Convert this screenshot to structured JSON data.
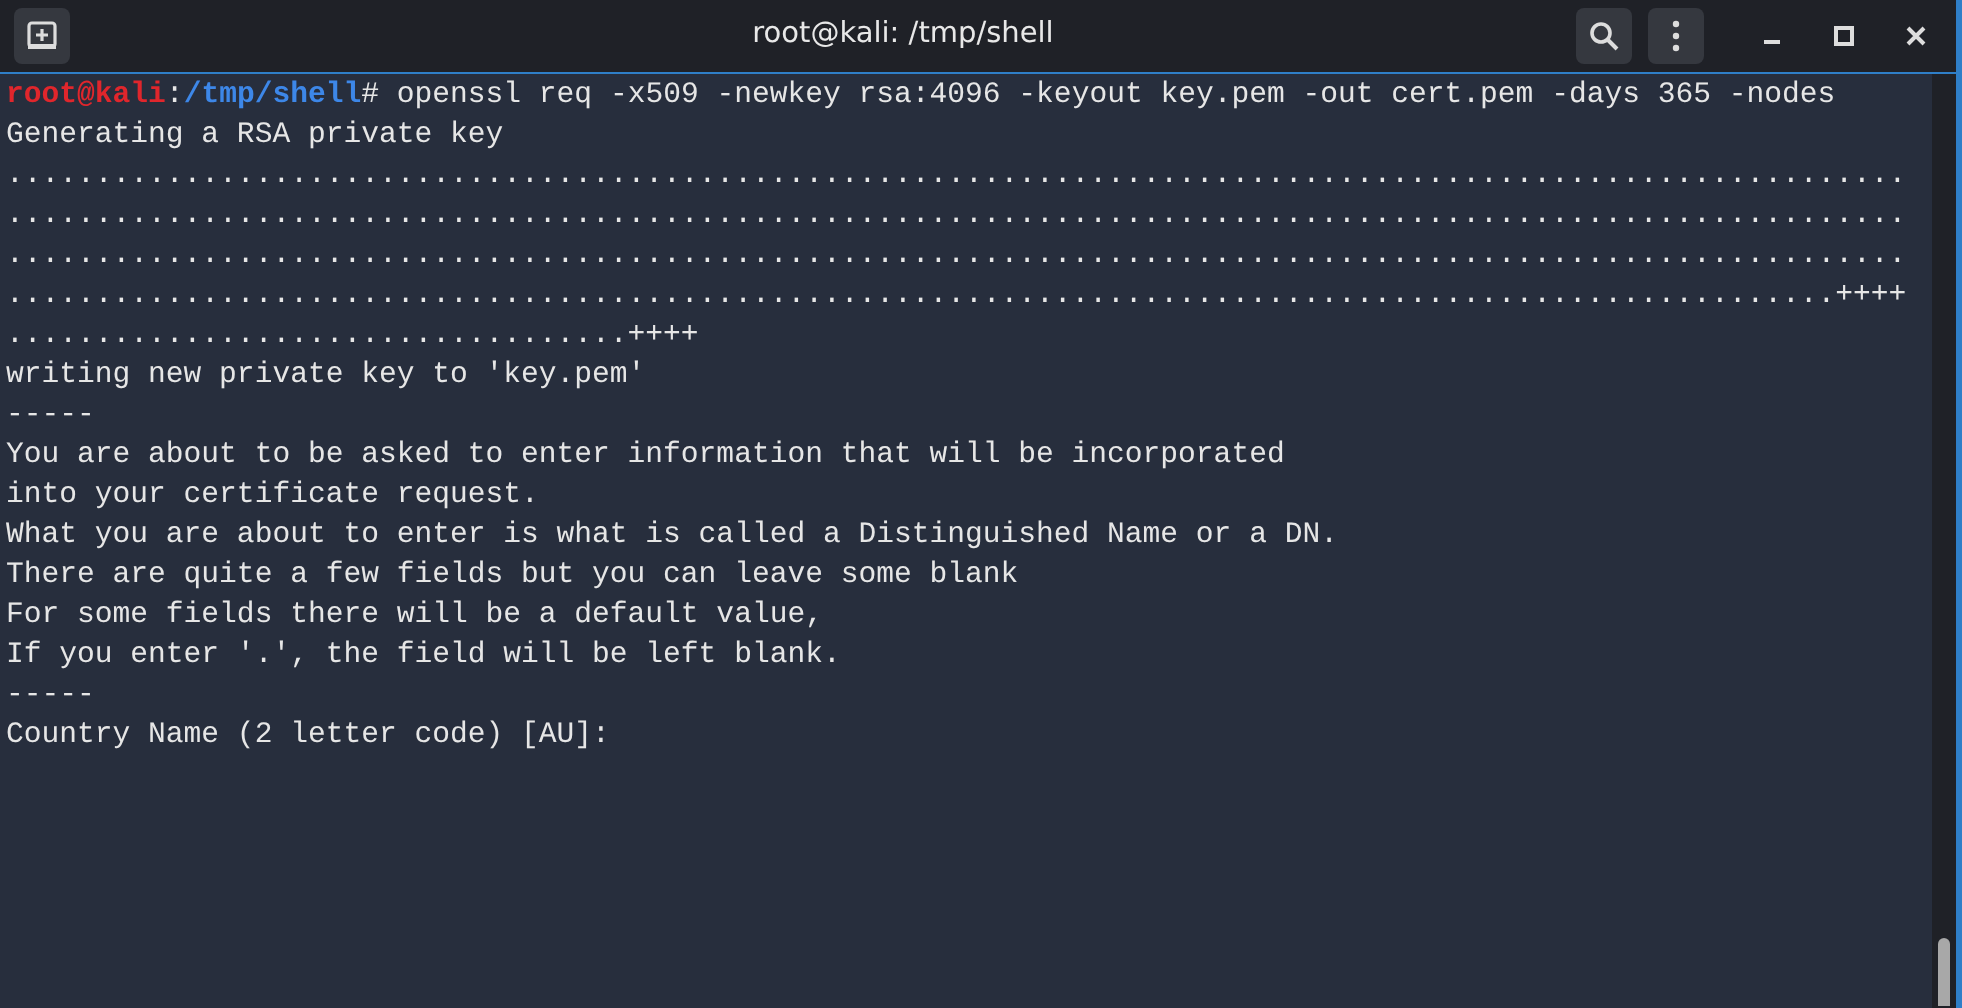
{
  "window": {
    "title": "root@kali: /tmp/shell"
  },
  "terminal": {
    "lines": [
      {
        "kind": "prompt",
        "user": "root@kali",
        "separator": ":",
        "path": "/tmp/shell",
        "symbol": "#",
        "command": "openssl req -x509 -newkey rsa:4096 -keyout key.pem -out cert.pem -days 365 -nodes"
      },
      {
        "kind": "output",
        "text": "Generating a RSA private key"
      },
      {
        "kind": "output",
        "text": "..........................................................................................................."
      },
      {
        "kind": "output",
        "text": "..........................................................................................................."
      },
      {
        "kind": "output",
        "text": "..........................................................................................................."
      },
      {
        "kind": "output",
        "text": ".......................................................................................................++++"
      },
      {
        "kind": "output",
        "text": "...................................++++"
      },
      {
        "kind": "output",
        "text": "writing new private key to 'key.pem'"
      },
      {
        "kind": "output",
        "text": "-----"
      },
      {
        "kind": "output",
        "text": "You are about to be asked to enter information that will be incorporated"
      },
      {
        "kind": "output",
        "text": "into your certificate request."
      },
      {
        "kind": "output",
        "text": "What you are about to enter is what is called a Distinguished Name or a DN."
      },
      {
        "kind": "output",
        "text": "There are quite a few fields but you can leave some blank"
      },
      {
        "kind": "output",
        "text": "For some fields there will be a default value,"
      },
      {
        "kind": "output",
        "text": "If you enter '.', the field will be left blank."
      },
      {
        "kind": "output",
        "text": "-----"
      },
      {
        "kind": "output",
        "text": "Country Name (2 letter code) [AU]:"
      }
    ]
  }
}
